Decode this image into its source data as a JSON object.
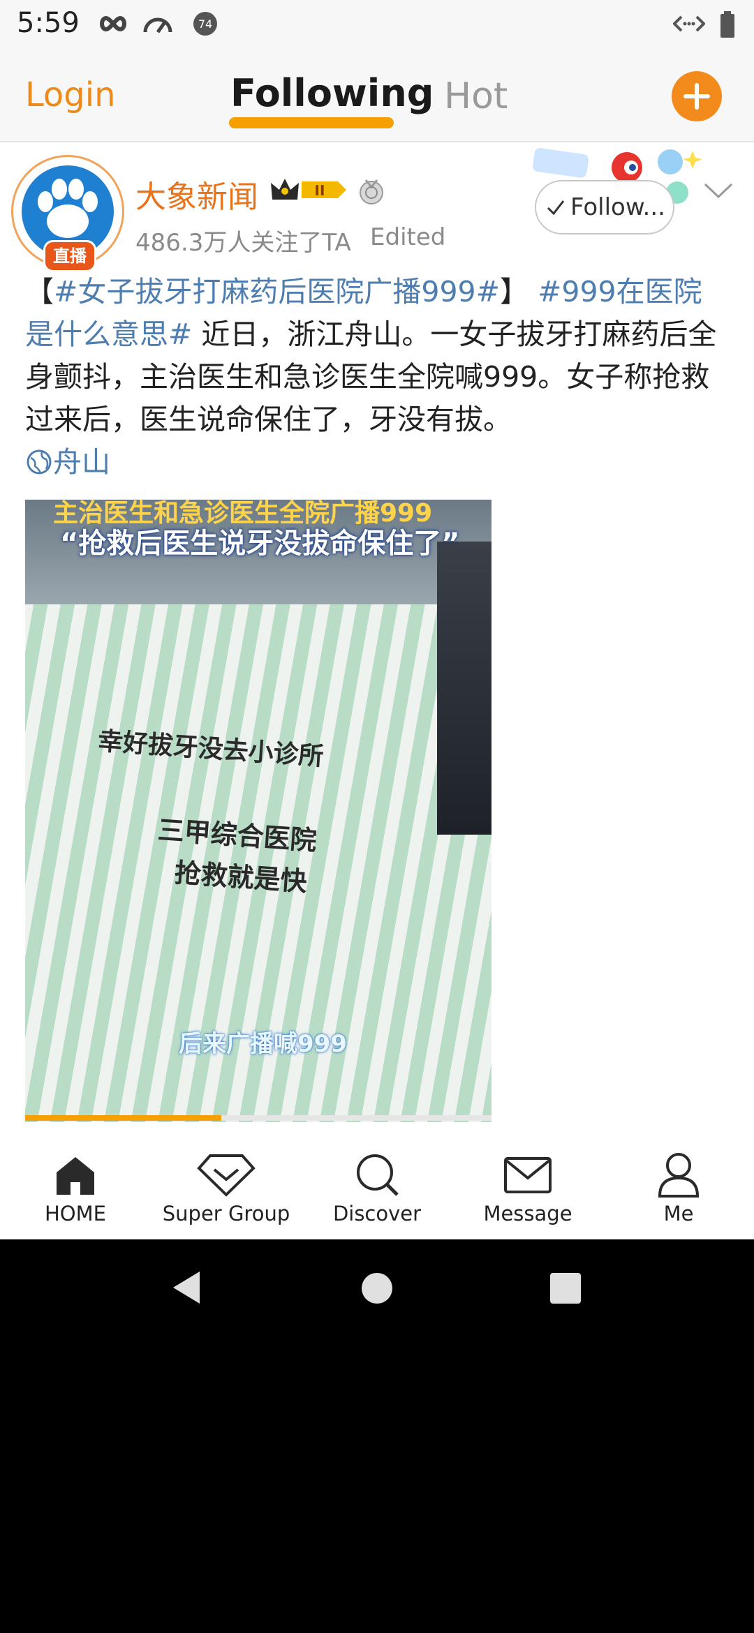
{
  "status_bar": {
    "time": "5:59",
    "left_icons": [
      "infinity-icon",
      "speedometer-icon",
      "notification-74-icon"
    ],
    "notification_count": "74",
    "right_icons": [
      "code-icon",
      "battery-icon"
    ]
  },
  "top_nav": {
    "login_label": "Login",
    "tabs": [
      {
        "label": "Following",
        "active": true
      },
      {
        "label": "Hot",
        "active": false
      }
    ],
    "add_icon": "plus-icon",
    "accent_color": "#f28b1c"
  },
  "post": {
    "author": {
      "name": "大象新闻",
      "live_badge": "直播",
      "followers": "486.3万人关注了TA",
      "edited": "Edited",
      "crown_level": "II"
    },
    "follow_button": "Follow...",
    "text": {
      "open_bracket": "【",
      "tag1": "#女子拔牙打麻药后医院广播999#",
      "close_bracket": "】",
      "tag2": "#999在医院是什么意思#",
      "body": " 近日，浙江舟山。一女子拔牙打麻药后全身颤抖，主治医生和急诊医生全院喊999。女子称抢救过来后，医生说命保住了，牙没有拔。",
      "location": "舟山"
    },
    "media": {
      "caption_top": "主治医生和急诊医生全院广播999",
      "caption_quote": "“抢救后医生说牙没拔命保住了”",
      "overlay_1": "幸好拔牙没去小诊所",
      "overlay_2": "三甲综合医院",
      "overlay_3": "抢救就是快",
      "overlay_bottom": "后来广播喊999",
      "progress_fraction": 0.42
    }
  },
  "bottom_nav": {
    "items": [
      {
        "label": "HOME",
        "icon": "home-icon"
      },
      {
        "label": "Super Group",
        "icon": "diamond-icon"
      },
      {
        "label": "Discover",
        "icon": "search-icon"
      },
      {
        "label": "Message",
        "icon": "envelope-icon"
      },
      {
        "label": "Me",
        "icon": "person-icon"
      }
    ]
  },
  "system_nav": [
    "back-icon",
    "home-circle-icon",
    "recents-icon"
  ]
}
